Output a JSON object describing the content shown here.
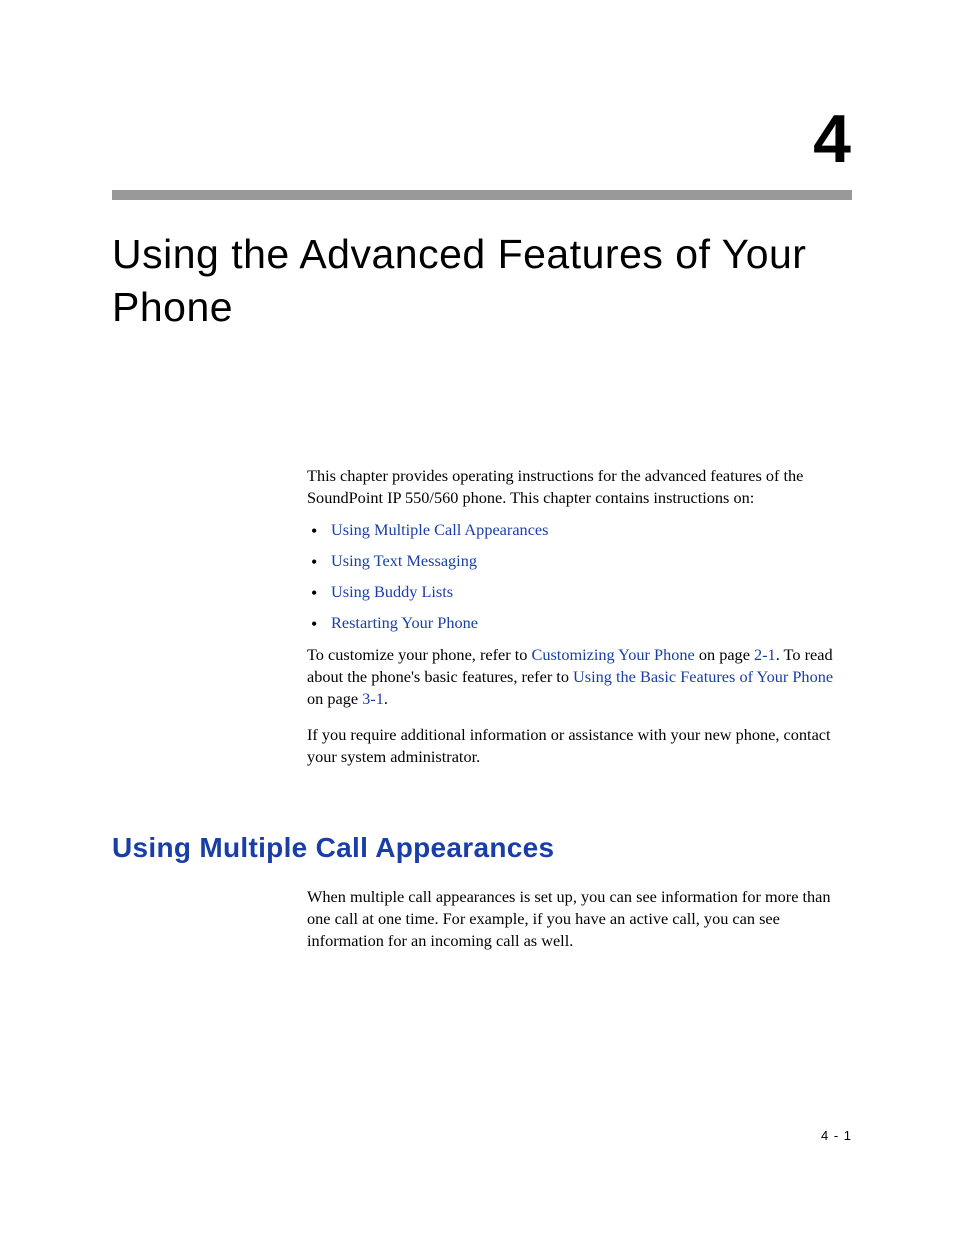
{
  "chapter": {
    "number": "4",
    "title": "Using the Advanced Features of Your Phone"
  },
  "intro": "This chapter provides operating instructions for the advanced features of the SoundPoint IP 550/560 phone. This chapter contains instructions on:",
  "bullets": [
    "Using Multiple Call Appearances",
    "Using Text Messaging",
    "Using Buddy Lists",
    "Restarting Your Phone"
  ],
  "customize": {
    "prefix": "To customize your phone, refer to ",
    "link1": "Customizing Your Phone",
    "mid1": " on page ",
    "pageref1": "2-1",
    "mid2": ". To read about the phone's basic features, refer to ",
    "link2": "Using the Basic Features of Your Phone",
    "mid3": " on page ",
    "pageref2": "3-1",
    "suffix": "."
  },
  "assist": "If you require additional information or assistance with your new phone, contact your system administrator.",
  "section": {
    "heading": "Using Multiple Call Appearances",
    "body": "When multiple call appearances is set up, you can see information for more than one call at one time. For example, if you have an active call, you can see information for an incoming call as well."
  },
  "pagenum": "4 - 1"
}
